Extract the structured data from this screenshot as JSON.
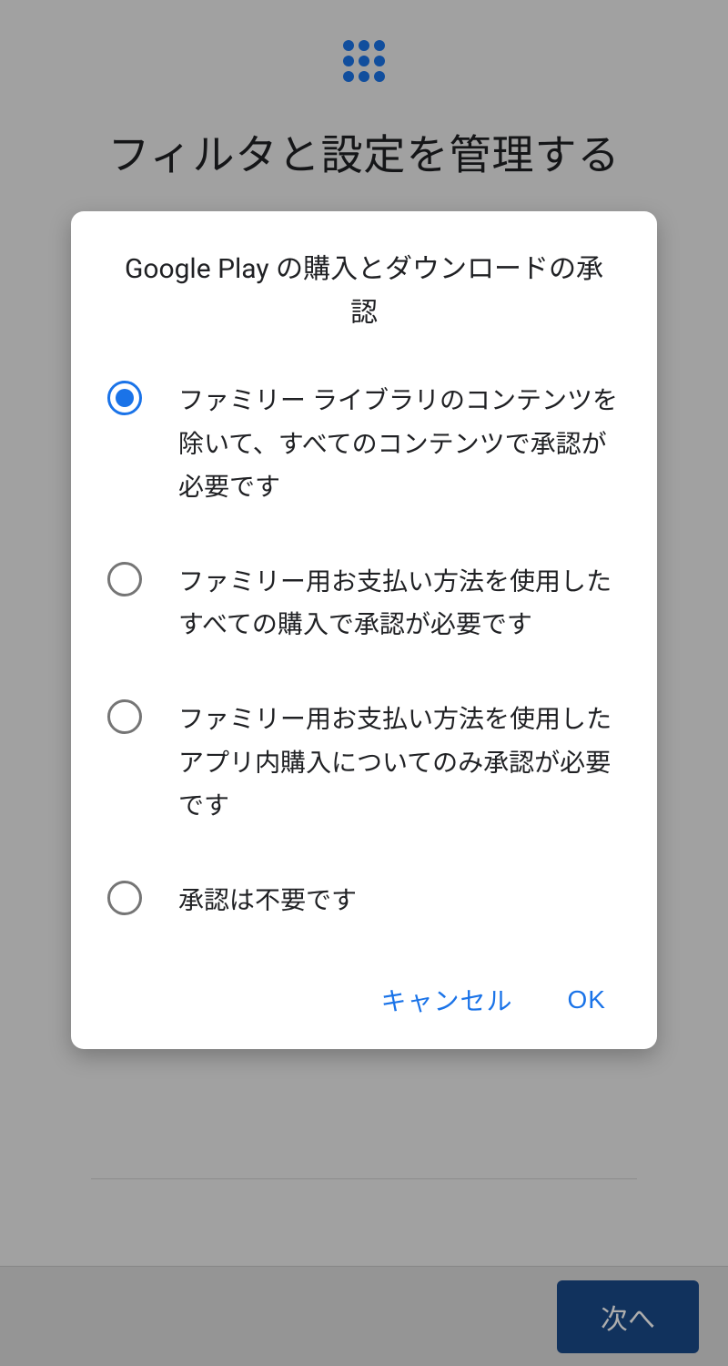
{
  "background": {
    "title": "フィルタと設定を管理する",
    "bottom_item_partial": ""
  },
  "dialog": {
    "title": "Google Play の購入とダウンロードの承認",
    "options": [
      {
        "label": "ファミリー ライブラリのコンテンツを除いて、すべてのコンテンツで承認が必要です",
        "selected": true
      },
      {
        "label": "ファミリー用お支払い方法を使用したすべての購入で承認が必要です",
        "selected": false
      },
      {
        "label": "ファミリー用お支払い方法を使用したアプリ内購入についてのみ承認が必要です",
        "selected": false
      },
      {
        "label": "承認は不要です",
        "selected": false
      }
    ],
    "cancel_label": "キャンセル",
    "ok_label": "OK"
  },
  "footer": {
    "next_label": "次へ"
  }
}
